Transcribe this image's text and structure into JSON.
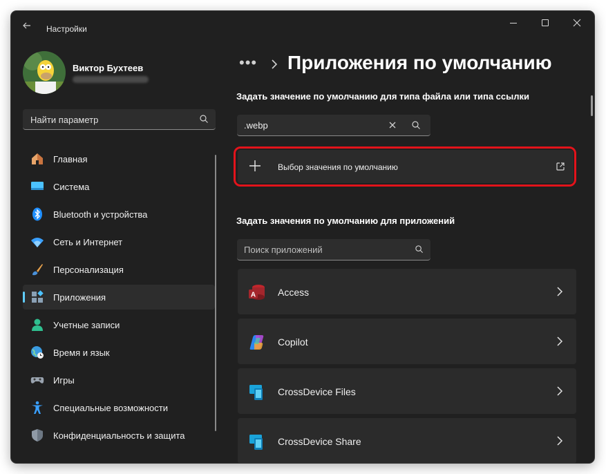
{
  "window": {
    "title": "Настройки",
    "controls": [
      "minimize-icon",
      "maximize-icon",
      "close-icon"
    ]
  },
  "profile": {
    "name": "Виктор Бухтеев"
  },
  "sidebar": {
    "search_placeholder": "Найти параметр",
    "items": [
      {
        "label": "Главная",
        "icon": "home-icon",
        "color": "#e8a56a"
      },
      {
        "label": "Система",
        "icon": "system-icon",
        "color": "#4cc2ff"
      },
      {
        "label": "Bluetooth и устройства",
        "icon": "bluetooth-icon",
        "color": "#1f8fff"
      },
      {
        "label": "Сеть и Интернет",
        "icon": "wifi-icon",
        "color": "#3aa0ff"
      },
      {
        "label": "Персонализация",
        "icon": "brush-icon",
        "color": "#e6a04c"
      },
      {
        "label": "Приложения",
        "icon": "apps-icon",
        "color": "#7aaed6",
        "selected": true
      },
      {
        "label": "Учетные записи",
        "icon": "account-icon",
        "color": "#2fbf8f"
      },
      {
        "label": "Время и язык",
        "icon": "globe-clock-icon",
        "color": "#3a9be0"
      },
      {
        "label": "Игры",
        "icon": "gamepad-icon",
        "color": "#9aa4b0"
      },
      {
        "label": "Специальные возможности",
        "icon": "accessibility-icon",
        "color": "#3aa0ff"
      },
      {
        "label": "Конфиденциальность и защита",
        "icon": "shield-icon",
        "color": "#8f9aa6"
      }
    ]
  },
  "main": {
    "breadcrumb_more": "•••",
    "title": "Приложения по умолчанию",
    "filetype_section_label": "Задать значение по умолчанию для типа файла или типа ссылки",
    "filetype_search_value": ".webp",
    "default_choice_label": "Выбор значения по умолчанию",
    "apps_section_label": "Задать значения по умолчанию для приложений",
    "apps_search_placeholder": "Поиск приложений",
    "apps": [
      {
        "label": "Access",
        "icon": "access-icon"
      },
      {
        "label": "Copilot",
        "icon": "copilot-icon"
      },
      {
        "label": "CrossDevice Files",
        "icon": "crossdevice-icon"
      },
      {
        "label": "CrossDevice Share",
        "icon": "crossdevice-icon"
      }
    ]
  },
  "colors": {
    "background": "#202020",
    "card": "#2b2b2b",
    "accent": "#60cdff",
    "highlight": "#e3131b"
  }
}
